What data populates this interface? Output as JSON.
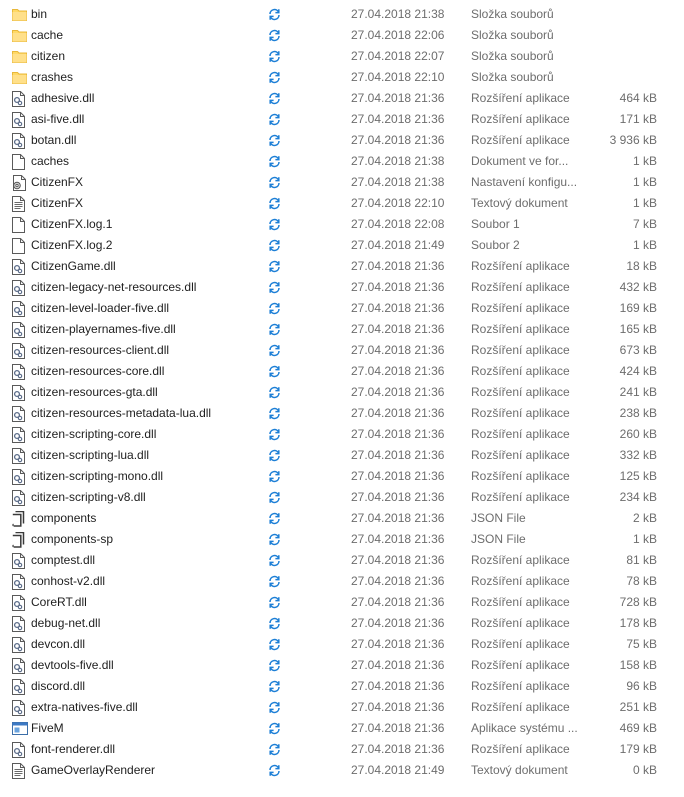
{
  "colors": {
    "folder": "#ffd966",
    "folder_dark": "#e8b83a",
    "sync_icon": "#1d7fd6",
    "meta_text": "#6d6d6d",
    "name_text": "#1e1e1e"
  },
  "files": [
    {
      "name": "bin",
      "date": "27.04.2018 21:38",
      "type": "Složka souborů",
      "size": "",
      "icon": "folder-icon"
    },
    {
      "name": "cache",
      "date": "27.04.2018 22:06",
      "type": "Složka souborů",
      "size": "",
      "icon": "folder-icon"
    },
    {
      "name": "citizen",
      "date": "27.04.2018 22:07",
      "type": "Složka souborů",
      "size": "",
      "icon": "folder-icon"
    },
    {
      "name": "crashes",
      "date": "27.04.2018 22:10",
      "type": "Složka souborů",
      "size": "",
      "icon": "folder-icon"
    },
    {
      "name": "adhesive.dll",
      "date": "27.04.2018 21:36",
      "type": "Rozšíření aplikace",
      "size": "464 kB",
      "icon": "dll-icon"
    },
    {
      "name": "asi-five.dll",
      "date": "27.04.2018 21:36",
      "type": "Rozšíření aplikace",
      "size": "171 kB",
      "icon": "dll-icon"
    },
    {
      "name": "botan.dll",
      "date": "27.04.2018 21:36",
      "type": "Rozšíření aplikace",
      "size": "3 936 kB",
      "icon": "dll-icon"
    },
    {
      "name": "caches",
      "date": "27.04.2018 21:38",
      "type": "Dokument ve for...",
      "size": "1 kB",
      "icon": "blank-document-icon"
    },
    {
      "name": "CitizenFX",
      "date": "27.04.2018 21:38",
      "type": "Nastavení konfigu...",
      "size": "1 kB",
      "icon": "config-file-icon"
    },
    {
      "name": "CitizenFX",
      "date": "27.04.2018 22:10",
      "type": "Textový dokument",
      "size": "1 kB",
      "icon": "text-document-icon"
    },
    {
      "name": "CitizenFX.log.1",
      "date": "27.04.2018 22:08",
      "type": "Soubor 1",
      "size": "7 kB",
      "icon": "blank-document-icon"
    },
    {
      "name": "CitizenFX.log.2",
      "date": "27.04.2018 21:49",
      "type": "Soubor 2",
      "size": "1 kB",
      "icon": "blank-document-icon"
    },
    {
      "name": "CitizenGame.dll",
      "date": "27.04.2018 21:36",
      "type": "Rozšíření aplikace",
      "size": "18 kB",
      "icon": "dll-icon"
    },
    {
      "name": "citizen-legacy-net-resources.dll",
      "date": "27.04.2018 21:36",
      "type": "Rozšíření aplikace",
      "size": "432 kB",
      "icon": "dll-icon"
    },
    {
      "name": "citizen-level-loader-five.dll",
      "date": "27.04.2018 21:36",
      "type": "Rozšíření aplikace",
      "size": "169 kB",
      "icon": "dll-icon"
    },
    {
      "name": "citizen-playernames-five.dll",
      "date": "27.04.2018 21:36",
      "type": "Rozšíření aplikace",
      "size": "165 kB",
      "icon": "dll-icon"
    },
    {
      "name": "citizen-resources-client.dll",
      "date": "27.04.2018 21:36",
      "type": "Rozšíření aplikace",
      "size": "673 kB",
      "icon": "dll-icon"
    },
    {
      "name": "citizen-resources-core.dll",
      "date": "27.04.2018 21:36",
      "type": "Rozšíření aplikace",
      "size": "424 kB",
      "icon": "dll-icon"
    },
    {
      "name": "citizen-resources-gta.dll",
      "date": "27.04.2018 21:36",
      "type": "Rozšíření aplikace",
      "size": "241 kB",
      "icon": "dll-icon"
    },
    {
      "name": "citizen-resources-metadata-lua.dll",
      "date": "27.04.2018 21:36",
      "type": "Rozšíření aplikace",
      "size": "238 kB",
      "icon": "dll-icon"
    },
    {
      "name": "citizen-scripting-core.dll",
      "date": "27.04.2018 21:36",
      "type": "Rozšíření aplikace",
      "size": "260 kB",
      "icon": "dll-icon"
    },
    {
      "name": "citizen-scripting-lua.dll",
      "date": "27.04.2018 21:36",
      "type": "Rozšíření aplikace",
      "size": "332 kB",
      "icon": "dll-icon"
    },
    {
      "name": "citizen-scripting-mono.dll",
      "date": "27.04.2018 21:36",
      "type": "Rozšíření aplikace",
      "size": "125 kB",
      "icon": "dll-icon"
    },
    {
      "name": "citizen-scripting-v8.dll",
      "date": "27.04.2018 21:36",
      "type": "Rozšíření aplikace",
      "size": "234 kB",
      "icon": "dll-icon"
    },
    {
      "name": "components",
      "date": "27.04.2018 21:36",
      "type": "JSON File",
      "size": "2 kB",
      "icon": "json-file-icon"
    },
    {
      "name": "components-sp",
      "date": "27.04.2018 21:36",
      "type": "JSON File",
      "size": "1 kB",
      "icon": "json-file-icon"
    },
    {
      "name": "comptest.dll",
      "date": "27.04.2018 21:36",
      "type": "Rozšíření aplikace",
      "size": "81 kB",
      "icon": "dll-icon"
    },
    {
      "name": "conhost-v2.dll",
      "date": "27.04.2018 21:36",
      "type": "Rozšíření aplikace",
      "size": "78 kB",
      "icon": "dll-icon"
    },
    {
      "name": "CoreRT.dll",
      "date": "27.04.2018 21:36",
      "type": "Rozšíření aplikace",
      "size": "728 kB",
      "icon": "dll-icon"
    },
    {
      "name": "debug-net.dll",
      "date": "27.04.2018 21:36",
      "type": "Rozšíření aplikace",
      "size": "178 kB",
      "icon": "dll-icon"
    },
    {
      "name": "devcon.dll",
      "date": "27.04.2018 21:36",
      "type": "Rozšíření aplikace",
      "size": "75 kB",
      "icon": "dll-icon"
    },
    {
      "name": "devtools-five.dll",
      "date": "27.04.2018 21:36",
      "type": "Rozšíření aplikace",
      "size": "158 kB",
      "icon": "dll-icon"
    },
    {
      "name": "discord.dll",
      "date": "27.04.2018 21:36",
      "type": "Rozšíření aplikace",
      "size": "96 kB",
      "icon": "dll-icon"
    },
    {
      "name": "extra-natives-five.dll",
      "date": "27.04.2018 21:36",
      "type": "Rozšíření aplikace",
      "size": "251 kB",
      "icon": "dll-icon"
    },
    {
      "name": "FiveM",
      "date": "27.04.2018 21:36",
      "type": "Aplikace systému ...",
      "size": "469 kB",
      "icon": "application-icon"
    },
    {
      "name": "font-renderer.dll",
      "date": "27.04.2018 21:36",
      "type": "Rozšíření aplikace",
      "size": "179 kB",
      "icon": "dll-icon"
    },
    {
      "name": "GameOverlayRenderer",
      "date": "27.04.2018 21:49",
      "type": "Textový dokument",
      "size": "0 kB",
      "icon": "text-document-icon"
    }
  ]
}
